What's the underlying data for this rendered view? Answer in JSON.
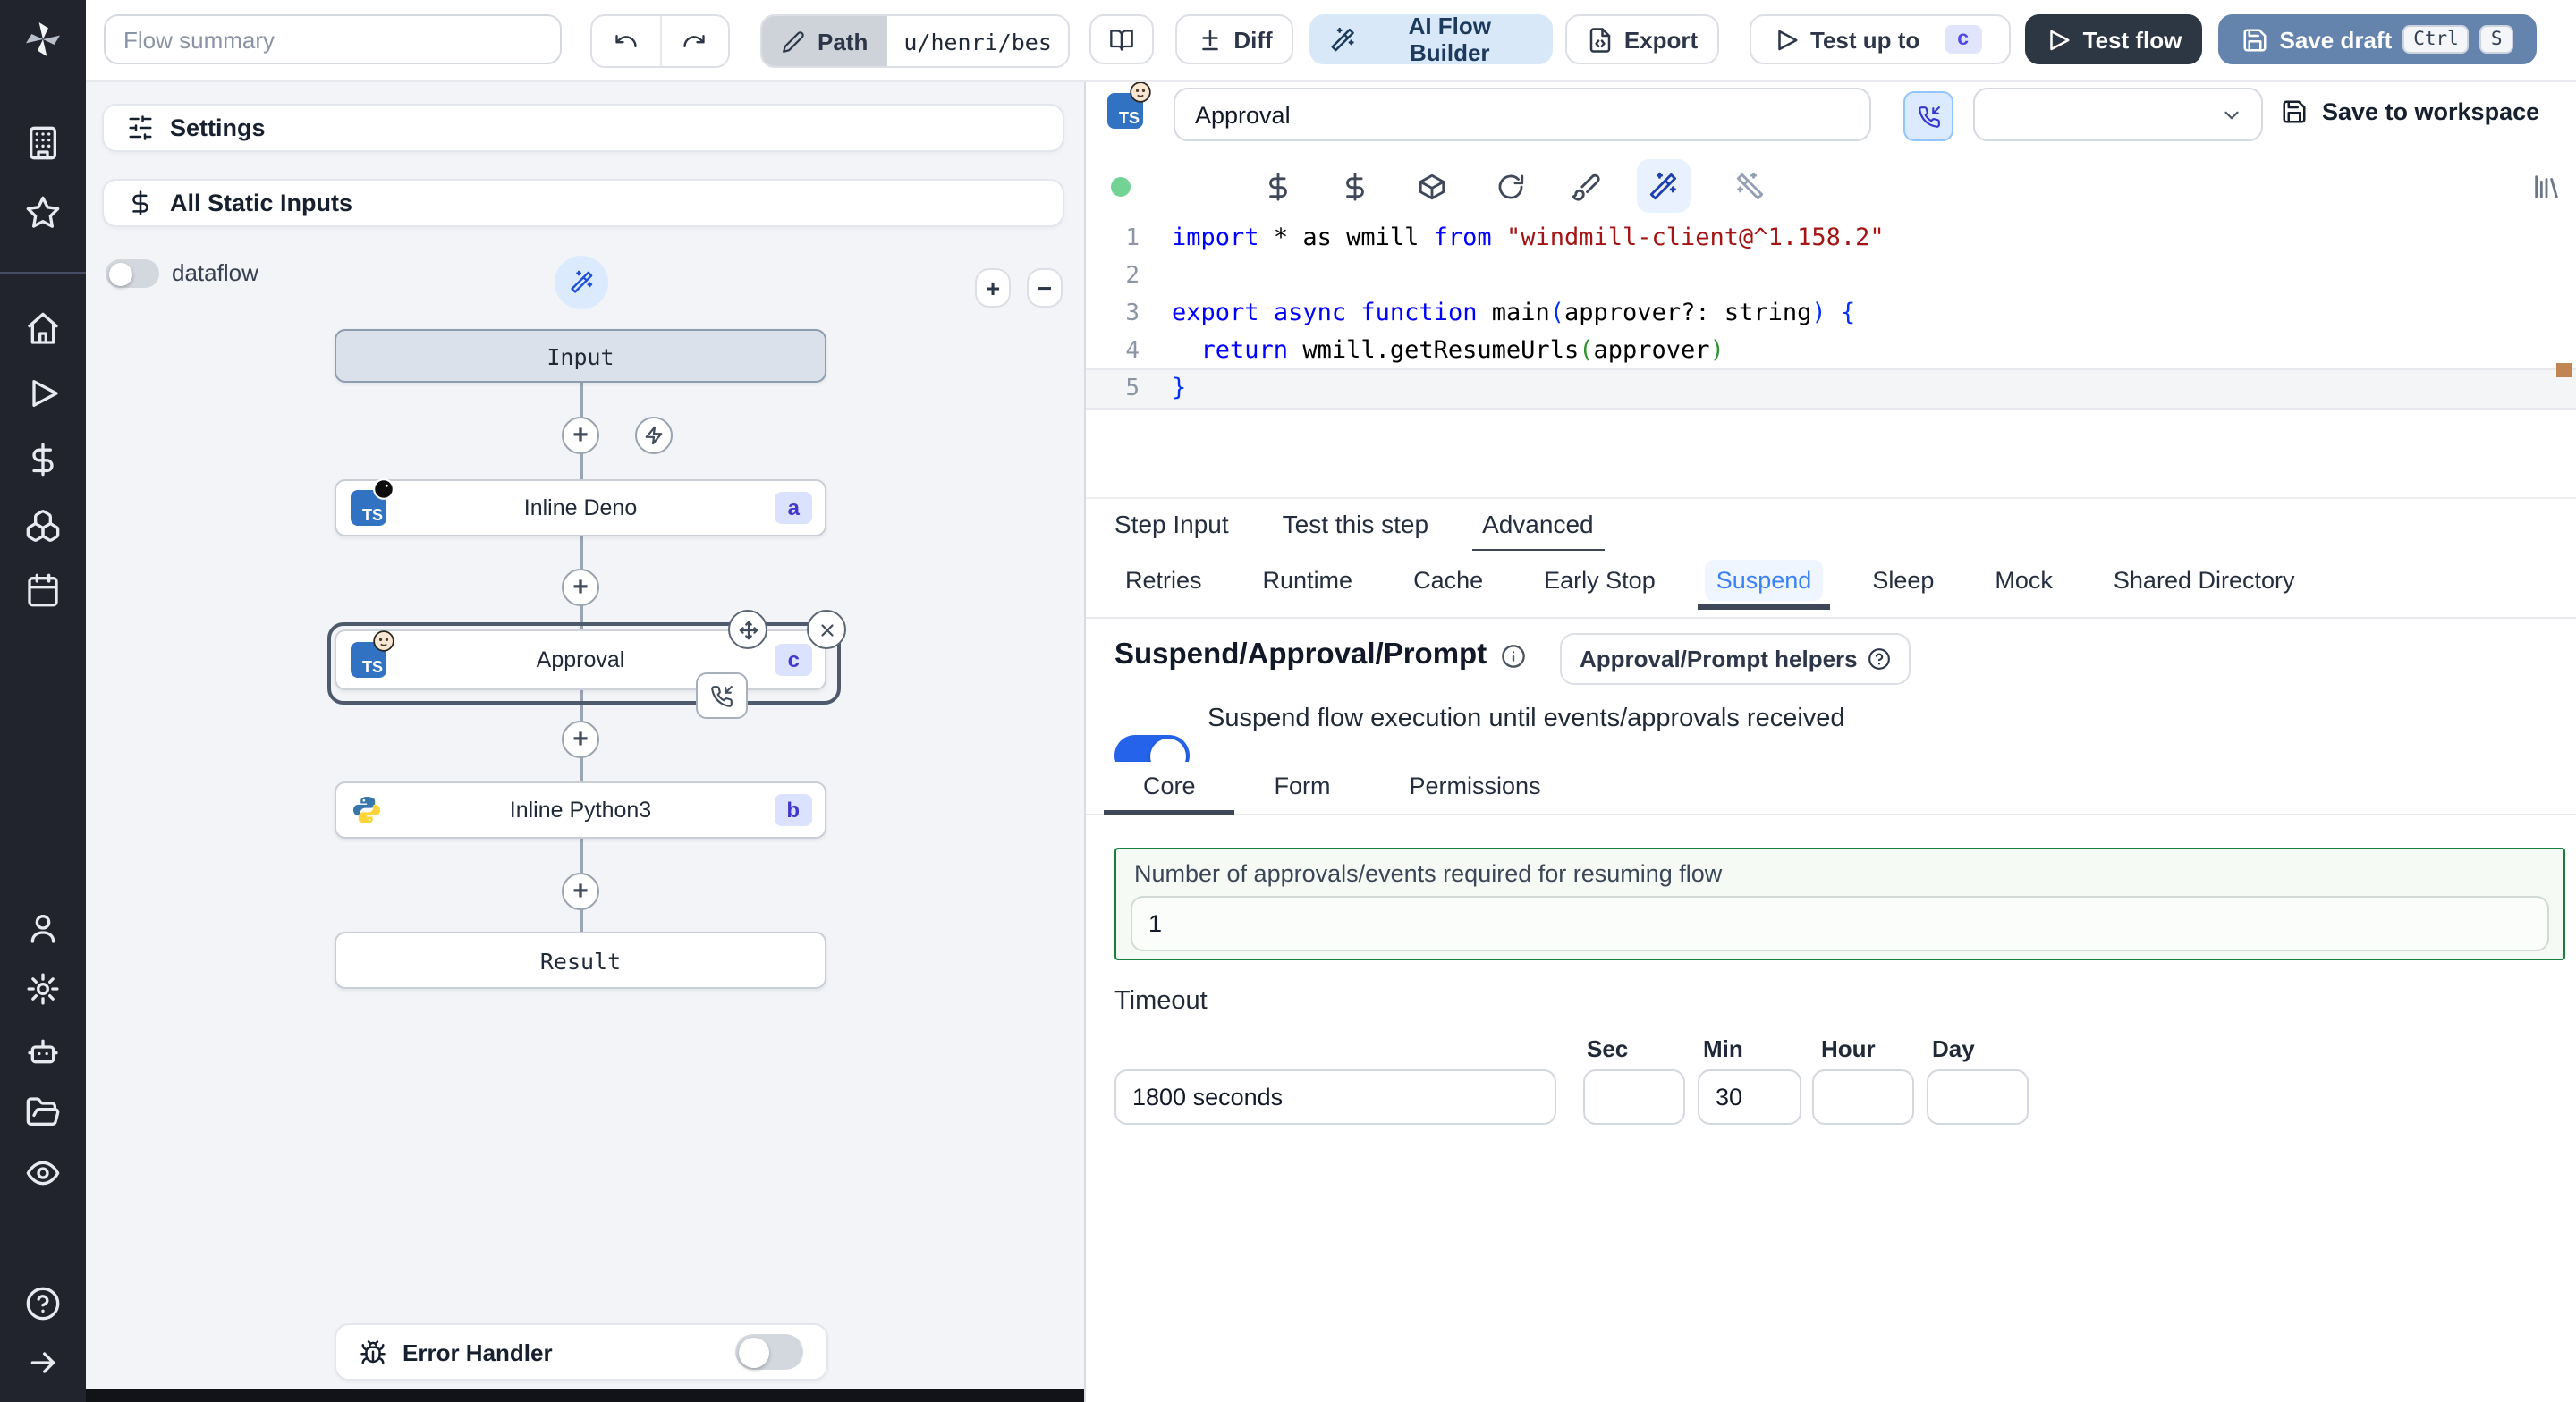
{
  "topbar": {
    "flow_summary_placeholder": "Flow summary",
    "path_label": "Path",
    "path_value": "u/henri/bes",
    "diff_label": "Diff",
    "ai_flow_builder_label": "AI Flow Builder",
    "export_label": "Export",
    "test_up_to_label": "Test up to",
    "test_up_to_badge": "c",
    "test_flow_label": "Test flow",
    "save_draft_label": "Save draft",
    "kbd_ctrl": "Ctrl",
    "kbd_s": "S"
  },
  "flow_panel": {
    "settings_label": "Settings",
    "static_inputs_label": "All Static Inputs",
    "dataflow_label": "dataflow",
    "graph": {
      "input_label": "Input",
      "result_label": "Result",
      "steps": [
        {
          "name": "Inline Deno",
          "id": "a"
        },
        {
          "name": "Approval",
          "id": "c"
        },
        {
          "name": "Inline Python3",
          "id": "b"
        }
      ]
    },
    "error_handler_label": "Error Handler"
  },
  "editor": {
    "step_title": "Approval",
    "save_to_workspace_label": "Save to workspace",
    "code": {
      "lines": [
        {
          "n": "1",
          "tokens": [
            {
              "t": "import",
              "c": "kw"
            },
            {
              "t": " * as wmill ",
              "c": "pl"
            },
            {
              "t": "from",
              "c": "kw"
            },
            {
              "t": " ",
              "c": "pl"
            },
            {
              "t": "\"windmill-client@^1.158.2\"",
              "c": "str"
            }
          ]
        },
        {
          "n": "2",
          "tokens": []
        },
        {
          "n": "3",
          "tokens": [
            {
              "t": "export",
              "c": "kw"
            },
            {
              "t": " ",
              "c": "pl"
            },
            {
              "t": "async",
              "c": "kw"
            },
            {
              "t": " ",
              "c": "pl"
            },
            {
              "t": "function",
              "c": "kw"
            },
            {
              "t": " main",
              "c": "pl"
            },
            {
              "t": "(",
              "c": "br1"
            },
            {
              "t": "approver?: string",
              "c": "pl"
            },
            {
              "t": ")",
              "c": "br1"
            },
            {
              "t": " ",
              "c": "pl"
            },
            {
              "t": "{",
              "c": "br1"
            }
          ]
        },
        {
          "n": "4",
          "tokens": [
            {
              "t": "  ",
              "c": "pl"
            },
            {
              "t": "return",
              "c": "kw"
            },
            {
              "t": " wmill.getResumeUrls",
              "c": "pl"
            },
            {
              "t": "(",
              "c": "br2"
            },
            {
              "t": "approver",
              "c": "pl"
            },
            {
              "t": ")",
              "c": "br2"
            }
          ]
        },
        {
          "n": "5",
          "tokens": [
            {
              "t": "}",
              "c": "br1"
            }
          ]
        }
      ]
    },
    "tabs": [
      {
        "label": "Step Input"
      },
      {
        "label": "Test this step"
      },
      {
        "label": "Advanced"
      }
    ],
    "subtabs": [
      {
        "label": "Retries"
      },
      {
        "label": "Runtime"
      },
      {
        "label": "Cache"
      },
      {
        "label": "Early Stop"
      },
      {
        "label": "Suspend"
      },
      {
        "label": "Sleep"
      },
      {
        "label": "Mock"
      },
      {
        "label": "Shared Directory"
      }
    ]
  },
  "suspend": {
    "heading": "Suspend/Approval/Prompt",
    "helpers_button_label": "Approval/Prompt helpers",
    "toggle_label": "Suspend flow execution until events/approvals received",
    "tabs": [
      {
        "label": "Core"
      },
      {
        "label": "Form"
      },
      {
        "label": "Permissions"
      }
    ],
    "approvals_label": "Number of approvals/events required for resuming flow",
    "approvals_value": "1",
    "timeout_label": "Timeout",
    "timeout_main_value": "1800 seconds",
    "timeout_units": [
      {
        "label": "Sec",
        "value": ""
      },
      {
        "label": "Min",
        "value": "30"
      },
      {
        "label": "Hour",
        "value": ""
      },
      {
        "label": "Day",
        "value": ""
      }
    ]
  },
  "colors": {
    "accent_blue": "#2563eb",
    "save_draft_blue": "#6584ad",
    "dark_button": "#2d3643",
    "green_border": "#15803d",
    "badge_indigo_bg": "#dbe2fd",
    "badge_indigo_text": "#4338ca"
  }
}
